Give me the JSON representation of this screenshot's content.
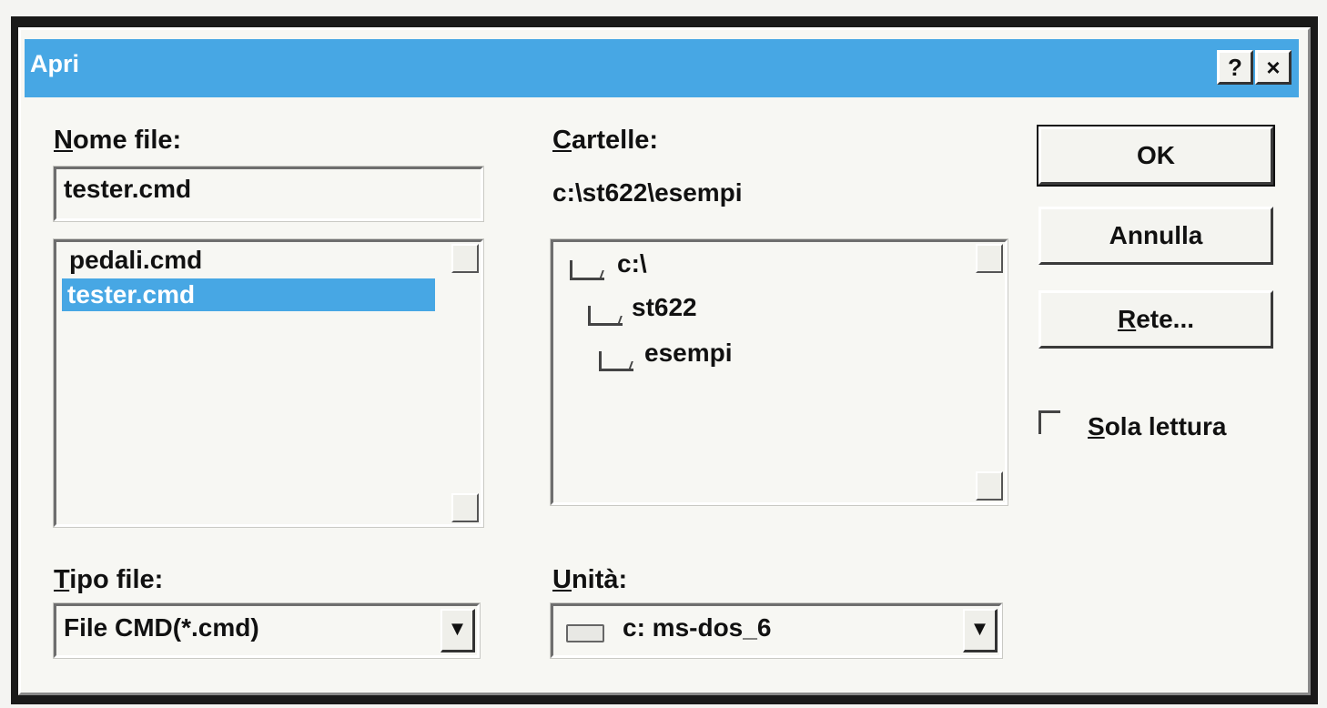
{
  "window": {
    "title": "Apri",
    "help_label": "?",
    "close_label": "×"
  },
  "filename": {
    "label_first": "N",
    "label_rest": "ome file:",
    "value": "tester.cmd",
    "files": [
      {
        "name": "pedali.cmd",
        "selected": false
      },
      {
        "name": "tester.cmd",
        "selected": true
      }
    ]
  },
  "folders": {
    "label_first": "C",
    "label_rest": "artelle:",
    "current_path": "c:\\st622\\esempi",
    "tree": [
      {
        "name": "c:\\",
        "icon": "open-folder-icon"
      },
      {
        "name": "st622",
        "icon": "open-folder-icon"
      },
      {
        "name": "esempi",
        "icon": "open-folder-icon"
      }
    ]
  },
  "buttons": {
    "ok": "OK",
    "cancel": "Annulla",
    "network_first": "R",
    "network_rest": "ete..."
  },
  "readonly": {
    "label_first": "S",
    "label_rest": "ola lettura",
    "checked": false
  },
  "file_type": {
    "label_first": "T",
    "label_rest": "ipo file:",
    "value": "File CMD(*.cmd)"
  },
  "drive": {
    "label_first": "U",
    "label_rest": "nità:",
    "value": "c: ms-dos_6",
    "icon": "drive-icon"
  },
  "colors": {
    "title_bar": "#47a7e4",
    "selection": "#47a7e4",
    "face": "#f7f7f3"
  }
}
